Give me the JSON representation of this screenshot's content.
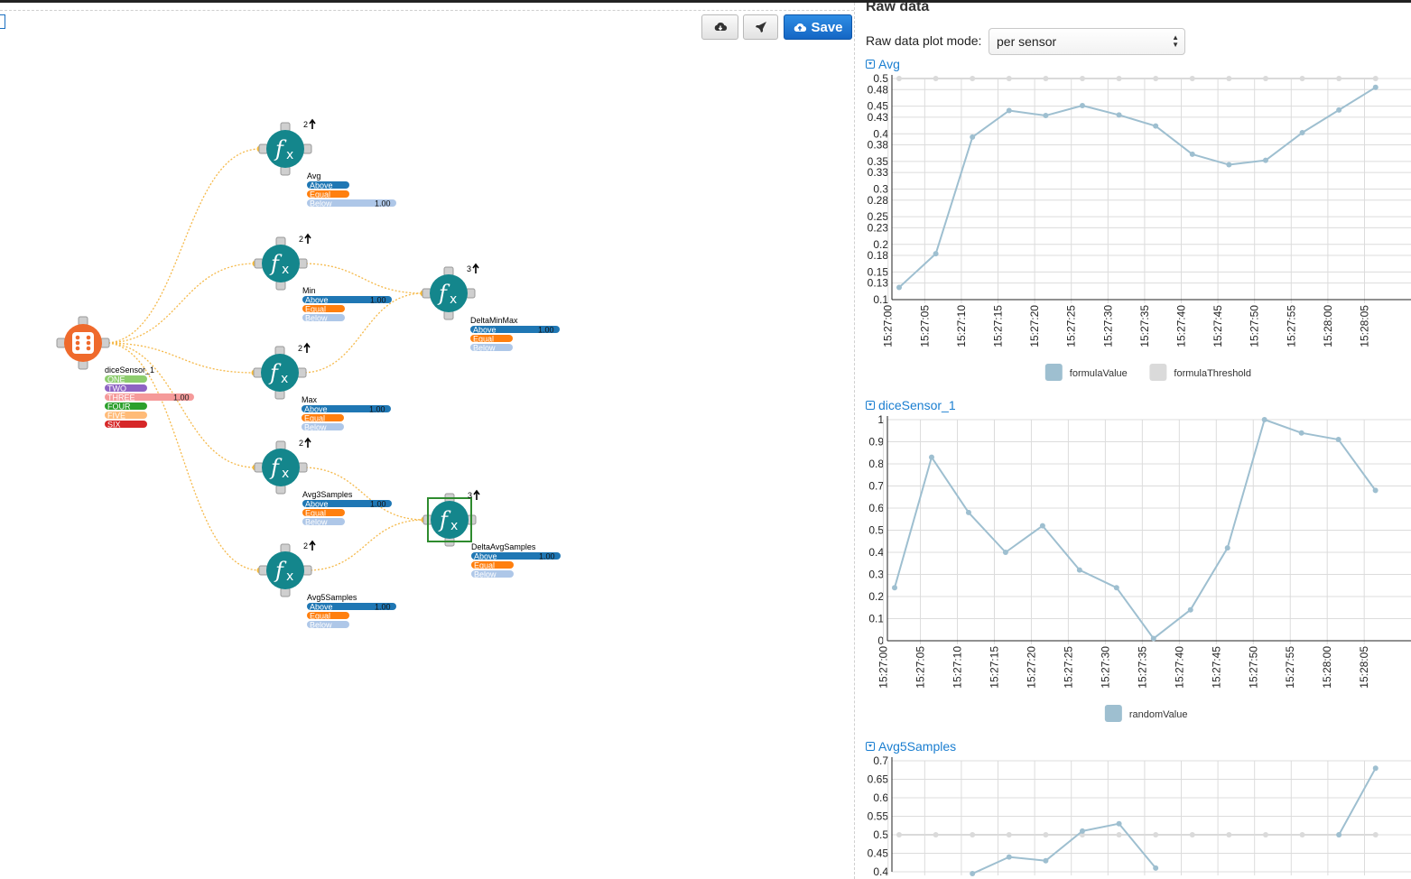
{
  "toolbar": {
    "cloud_download_icon": "cloud-download-icon",
    "deploy_icon": "rocket-icon",
    "save_label": "Save"
  },
  "graph": {
    "source": {
      "name": "diceSensor_1",
      "states": [
        {
          "label": "ONE",
          "color": "#8dcd6e",
          "value": ""
        },
        {
          "label": "TWO",
          "color": "#8e63c3",
          "value": ""
        },
        {
          "label": "THREE",
          "color": "#f59a9a",
          "value": "1.00"
        },
        {
          "label": "FOUR",
          "color": "#2ca02c",
          "value": ""
        },
        {
          "label": "FIVE",
          "color": "#ffbb78",
          "value": ""
        },
        {
          "label": "SIX",
          "color": "#d62728",
          "value": ""
        }
      ]
    },
    "nodes": [
      {
        "name": "Avg",
        "count": "2",
        "above": "",
        "equal": "",
        "below": "1.00"
      },
      {
        "name": "Min",
        "count": "2",
        "above": "1.00",
        "equal": "",
        "below": ""
      },
      {
        "name": "Max",
        "count": "2",
        "above": "1.00",
        "equal": "",
        "below": ""
      },
      {
        "name": "Avg3Samples",
        "count": "2",
        "above": "1.00",
        "equal": "",
        "below": ""
      },
      {
        "name": "Avg5Samples",
        "count": "2",
        "above": "1.00",
        "equal": "",
        "below": ""
      },
      {
        "name": "DeltaMinMax",
        "count": "3",
        "above": "1.00",
        "equal": "",
        "below": ""
      },
      {
        "name": "DeltaAvgSamples",
        "count": "3",
        "above": "1.00",
        "equal": "",
        "below": ""
      }
    ],
    "state_labels": {
      "above": "Above",
      "equal": "Equal",
      "below": "Below"
    },
    "state_colors": {
      "above": "#1f77b4",
      "equal": "#ff7f0e",
      "below": "#aec7e8"
    }
  },
  "raw": {
    "title": "Raw data",
    "mode_label": "Raw data plot mode:",
    "mode_value": "per sensor"
  },
  "x_ticks": [
    "15:27:00",
    "15:27:05",
    "15:27:10",
    "15:27:15",
    "15:27:20",
    "15:27:25",
    "15:27:30",
    "15:27:35",
    "15:27:40",
    "15:27:45",
    "15:27:50",
    "15:27:55",
    "15:28:00",
    "15:28:05"
  ],
  "chart_data": [
    {
      "type": "line",
      "title": "Avg",
      "ylim": [
        0.1,
        0.5
      ],
      "yticks": [
        "0.5",
        "0.48",
        "0.45",
        "0.43",
        "0.4",
        "0.38",
        "0.35",
        "0.33",
        "0.3",
        "0.28",
        "0.25",
        "0.23",
        "0.2",
        "0.18",
        "0.15",
        "0.13",
        "0.1"
      ],
      "series": [
        {
          "name": "formulaValue",
          "color": "#9ebfd0",
          "values": [
            0.122,
            0.183,
            0.394,
            0.442,
            0.433,
            0.451,
            0.434,
            0.414,
            0.363,
            0.344,
            0.352,
            0.402,
            0.443,
            0.484
          ]
        },
        {
          "name": "formulaThreshold",
          "color": "#dadada",
          "values": [
            0.5,
            0.5,
            0.5,
            0.5,
            0.5,
            0.5,
            0.5,
            0.5,
            0.5,
            0.5,
            0.5,
            0.5,
            0.5,
            0.5
          ]
        }
      ],
      "grid": true,
      "legend": "bottom"
    },
    {
      "type": "line",
      "title": "diceSensor_1",
      "ylim": [
        0,
        1
      ],
      "yticks": [
        "1",
        "0.9",
        "0.8",
        "0.7",
        "0.6",
        "0.5",
        "0.4",
        "0.3",
        "0.2",
        "0.1",
        "0"
      ],
      "series": [
        {
          "name": "randomValue",
          "color": "#9ebfd0",
          "values": [
            0.24,
            0.83,
            0.58,
            0.4,
            0.52,
            0.32,
            0.24,
            0.01,
            0.14,
            0.42,
            1.0,
            0.94,
            0.91,
            0.68
          ]
        }
      ],
      "grid": true,
      "legend": "bottom"
    },
    {
      "type": "line",
      "title": "Avg5Samples",
      "ylim": [
        0.4,
        0.7
      ],
      "yticks": [
        "0.7",
        "0.65",
        "0.6",
        "0.55",
        "0.5",
        "0.45",
        "0.4"
      ],
      "series": [
        {
          "name": "",
          "color": "#9ebfd0",
          "values": [
            null,
            null,
            0.395,
            0.44,
            0.43,
            0.51,
            0.53,
            0.41,
            null,
            null,
            null,
            null,
            0.5,
            0.68
          ]
        },
        {
          "name": "",
          "color": "#dadada",
          "values": [
            0.5,
            0.5,
            0.5,
            0.5,
            0.5,
            0.5,
            0.5,
            0.5,
            0.5,
            0.5,
            0.5,
            0.5,
            0.5,
            0.5
          ]
        }
      ],
      "grid": true,
      "legend": "none"
    }
  ]
}
